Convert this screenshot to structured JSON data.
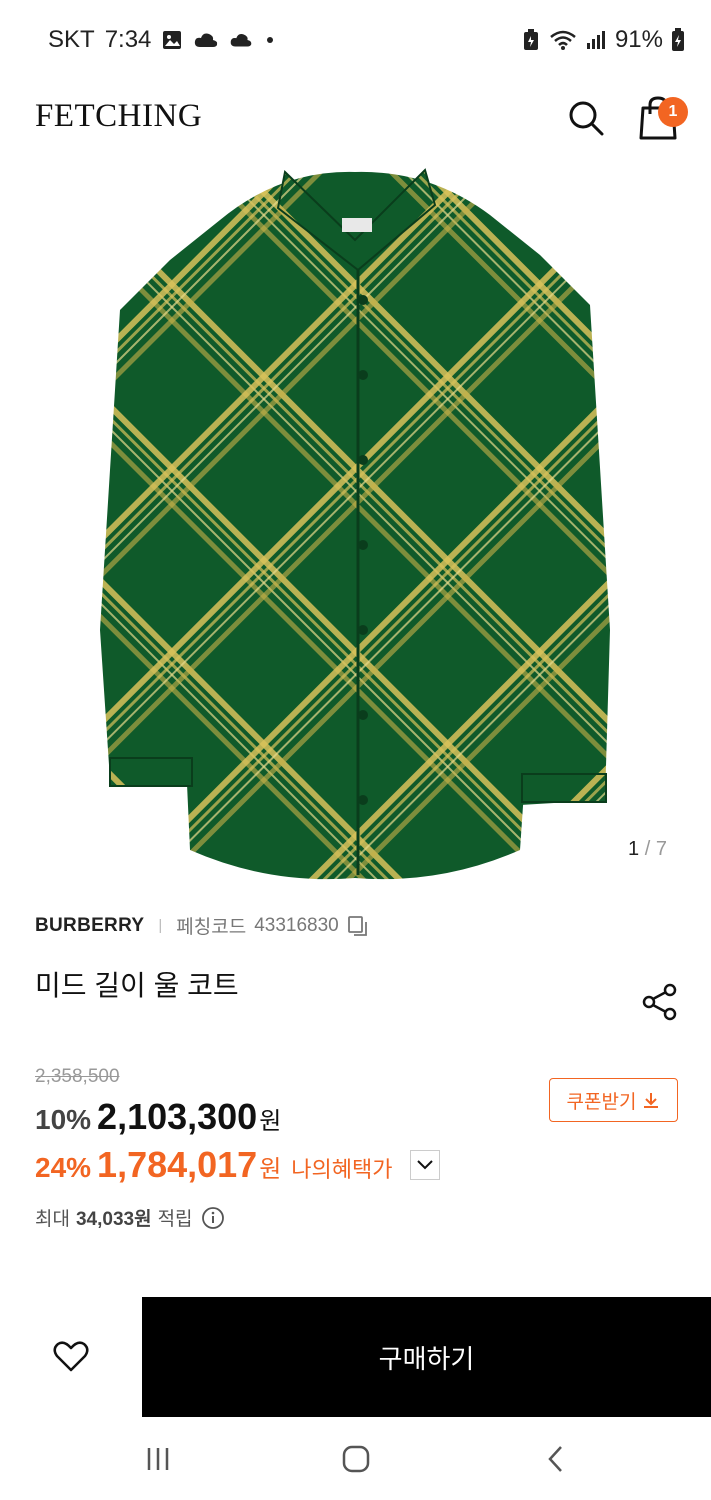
{
  "status_bar": {
    "carrier": "SKT",
    "time": "7:34",
    "battery": "91%",
    "icons": [
      "gallery-icon",
      "cloud-icon",
      "cloud-icon",
      "dot-icon",
      "battery-saver-icon",
      "wifi-icon",
      "signal-icon",
      "battery-icon"
    ]
  },
  "header": {
    "logo": "FETCHING",
    "search_icon": "search-icon",
    "cart_icon": "shopping-bag-icon",
    "cart_count": "1"
  },
  "gallery": {
    "current": "1",
    "divider": "/",
    "total": "7",
    "colors": {
      "fabric": "#0f5a2a",
      "check": "#d8c25a"
    }
  },
  "product": {
    "brand": "BURBERRY",
    "code_label": "페칭코드",
    "code_value": "43316830",
    "title": "미드 길이 울 코트"
  },
  "pricing": {
    "original_price": "2,358,500",
    "discount_rate": "10%",
    "sale_price": "2,103,300",
    "currency": "원",
    "benefit_rate": "24%",
    "benefit_price": "1,784,017",
    "benefit_currency": "원",
    "benefit_label": "나의혜택가",
    "coupon_label": "쿠폰받기",
    "accent_color": "#f26522"
  },
  "points": {
    "prefix": "최대",
    "value": "34,033원",
    "suffix": "적립"
  },
  "bottom": {
    "buy_label": "구매하기"
  },
  "nav": {
    "items": [
      "recent-apps-icon",
      "home-icon",
      "back-icon"
    ]
  }
}
